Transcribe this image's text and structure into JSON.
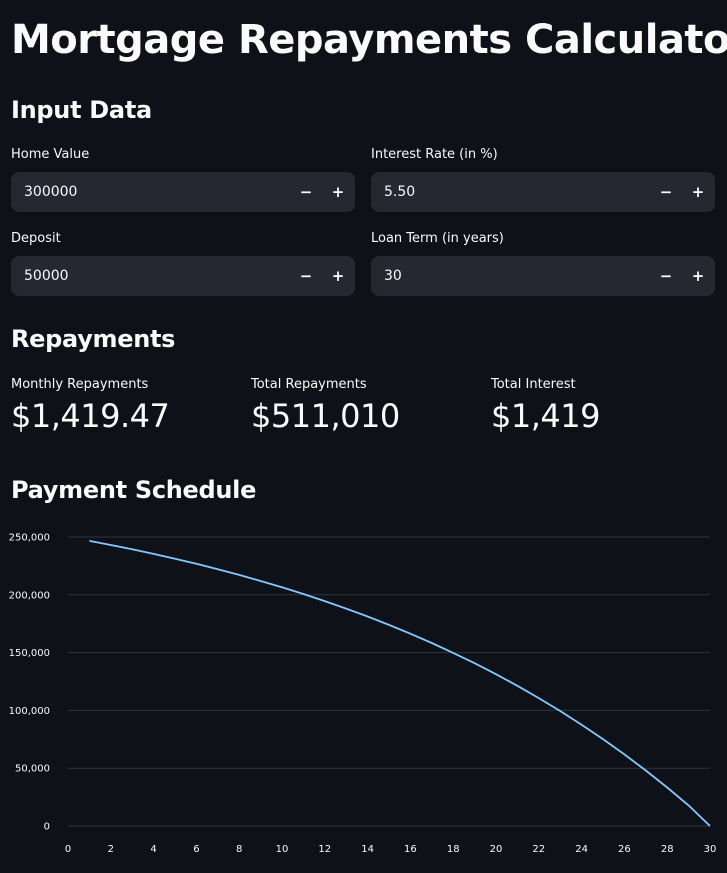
{
  "page_title": "Mortgage Repayments Calculator",
  "input_section": {
    "heading": "Input Data",
    "home_value": {
      "label": "Home Value",
      "value": "300000"
    },
    "interest_rate": {
      "label": "Interest Rate (in %)",
      "value": "5.50"
    },
    "deposit": {
      "label": "Deposit",
      "value": "50000"
    },
    "loan_term": {
      "label": "Loan Term (in years)",
      "value": "30"
    },
    "minus_symbol": "−",
    "plus_symbol": "+"
  },
  "repayments_section": {
    "heading": "Repayments",
    "monthly": {
      "label": "Monthly Repayments",
      "value": "$1,419.47"
    },
    "total": {
      "label": "Total Repayments",
      "value": "$511,010"
    },
    "interest": {
      "label": "Total Interest",
      "value": "$1,419"
    }
  },
  "schedule_section": {
    "heading": "Payment Schedule"
  },
  "colors": {
    "background": "#0e1117",
    "input_bg": "#262730",
    "line": "#83c9ff",
    "grid": "#31333f"
  },
  "chart_data": {
    "type": "line",
    "x_ticks": [
      "0",
      "2",
      "4",
      "6",
      "8",
      "10",
      "12",
      "14",
      "16",
      "18",
      "20",
      "22",
      "24",
      "26",
      "28",
      "30"
    ],
    "y_ticks": [
      "0",
      "50,000",
      "100,000",
      "150,000",
      "200,000",
      "250,000"
    ],
    "xlim": [
      0,
      30
    ],
    "ylim": [
      0,
      250000
    ],
    "grid": "horizontal",
    "series": [
      {
        "x": [
          1,
          2,
          3,
          4,
          5,
          6,
          7,
          8,
          9,
          10,
          11,
          12,
          13,
          14,
          15,
          16,
          17,
          18,
          19,
          20,
          21,
          22,
          23,
          24,
          25,
          26,
          27,
          28,
          29,
          30
        ],
        "values": [
          246640,
          243090,
          239340,
          235380,
          231200,
          226780,
          222110,
          217180,
          211980,
          206480,
          200670,
          194540,
          188060,
          181220,
          173990,
          166360,
          158300,
          149780,
          140790,
          131290,
          121260,
          110660,
          99470,
          87650,
          75160,
          61980,
          48050,
          33340,
          17800,
          0
        ]
      }
    ]
  }
}
